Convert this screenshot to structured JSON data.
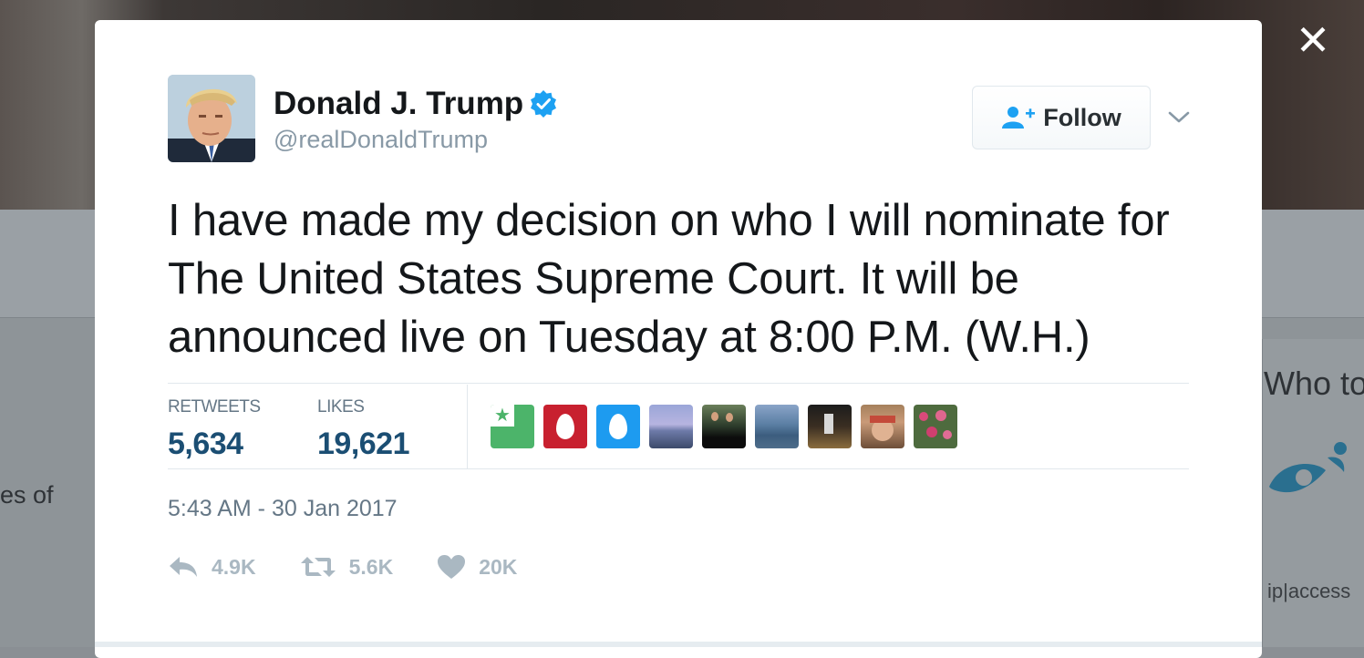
{
  "background": {
    "right_heading": "Who to",
    "left_snippet": "es of",
    "sponsor_text": "ip|access"
  },
  "modal": {
    "close_glyph": "✕",
    "author": {
      "name": "Donald J. Trump",
      "handle": "@realDonaldTrump",
      "verified": true
    },
    "follow_button": {
      "label": "Follow"
    },
    "tweet_text": "I have made my decision on who I will nominate for The United States Supreme Court. It will be announced live on Tuesday at 8:00 P.M. (W.H.)",
    "stats": {
      "retweets_label": "RETWEETS",
      "retweets_value": "5,634",
      "likes_label": "LIKES",
      "likes_value": "19,621"
    },
    "likers": [
      {
        "name": "liker-green-star"
      },
      {
        "name": "liker-red-egg"
      },
      {
        "name": "liker-blue-egg"
      },
      {
        "name": "liker-beach"
      },
      {
        "name": "liker-group-photo"
      },
      {
        "name": "liker-ocean"
      },
      {
        "name": "liker-sports"
      },
      {
        "name": "liker-person-cap"
      },
      {
        "name": "liker-flowers"
      }
    ],
    "timestamp": "5:43 AM - 30 Jan 2017",
    "actions": {
      "reply_count": "4.9K",
      "retweet_count": "5.6K",
      "like_count": "20K"
    }
  },
  "colors": {
    "accent_blue": "#1da1f2",
    "stat_value": "#1b4e73",
    "muted": "#657786"
  }
}
